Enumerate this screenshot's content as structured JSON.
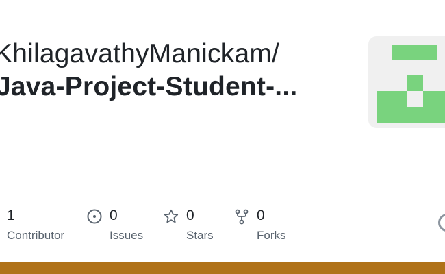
{
  "repo": {
    "owner": "KhilagavathyManickam/",
    "name": "Java-Project-Student-..."
  },
  "stats": [
    {
      "value": "1",
      "label": "Contributor",
      "icon": "none"
    },
    {
      "value": "0",
      "label": "Issues",
      "icon": "issue-opened-icon"
    },
    {
      "value": "0",
      "label": "Stars",
      "icon": "star-icon"
    },
    {
      "value": "0",
      "label": "Forks",
      "icon": "fork-icon"
    }
  ],
  "colors": {
    "identicon": "#79d37e",
    "identicon_bg": "#f0f0f0",
    "language_bar": "#b07219",
    "muted_text": "#59636e"
  }
}
